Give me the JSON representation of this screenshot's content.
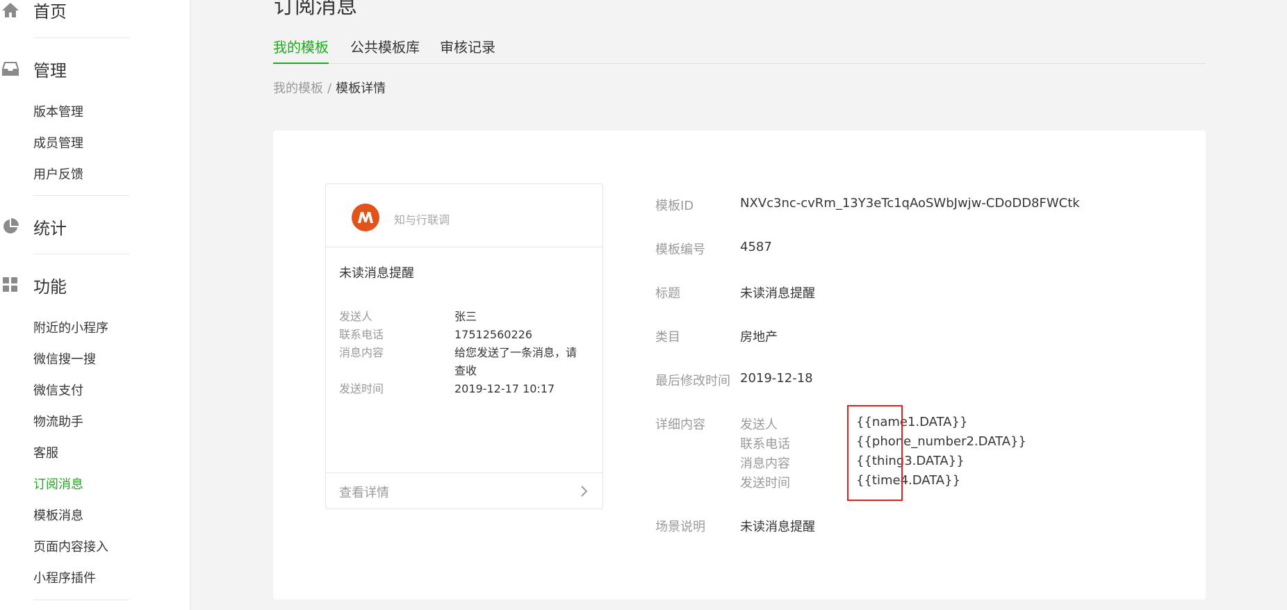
{
  "sidebar": {
    "groups": [
      {
        "title": "首页",
        "icon": "home-icon"
      },
      {
        "title": "管理",
        "icon": "inbox-icon",
        "items": [
          "版本管理",
          "成员管理",
          "用户反馈"
        ]
      },
      {
        "title": "统计",
        "icon": "pie-chart-icon"
      },
      {
        "title": "功能",
        "icon": "grid-icon",
        "items": [
          "附近的小程序",
          "微信搜一搜",
          "微信支付",
          "物流助手",
          "客服",
          "订阅消息",
          "模板消息",
          "页面内容接入",
          "小程序插件"
        ]
      }
    ],
    "active_item": "订阅消息"
  },
  "page": {
    "title": "订阅消息",
    "tabs": [
      "我的模板",
      "公共模板库",
      "审核记录"
    ],
    "active_tab": "我的模板",
    "breadcrumb": {
      "parent": "我的模板",
      "separator": "/",
      "current": "模板详情"
    }
  },
  "preview": {
    "app_name": "知与行联调",
    "title": "未读消息提醒",
    "rows": [
      {
        "label": "发送人",
        "value": "张三"
      },
      {
        "label": "联系电话",
        "value": "17512560226"
      },
      {
        "label": "消息内容",
        "value": "给您发送了一条消息，请查收"
      },
      {
        "label": "发送时间",
        "value": "2019-12-17 10:17"
      }
    ],
    "footer_link": "查看详情"
  },
  "detail": {
    "template_id_label": "模板ID",
    "template_id": "NXVc3nc-cvRm_13Y3eTc1qAoSWbJwjw-CDoDD8FWCtk",
    "number_label": "模板编号",
    "number": "4587",
    "title_label": "标题",
    "title": "未读消息提醒",
    "category_label": "类目",
    "category": "房地产",
    "modified_label": "最后修改时间",
    "modified": "2019-12-18",
    "content_label": "详细内容",
    "fields": [
      {
        "name": "发送人",
        "key": "{{name1.DATA}}"
      },
      {
        "name": "联系电话",
        "key": "{{phone_number2.DATA}}"
      },
      {
        "name": "消息内容",
        "key": "{{thing3.DATA}}"
      },
      {
        "name": "发送时间",
        "key": "{{time4.DATA}}"
      }
    ],
    "scene_label": "场景说明",
    "scene": "未读消息提醒"
  },
  "colors": {
    "accent": "#1aad19",
    "highlight": "#e02020",
    "logo": "#e2531b"
  }
}
